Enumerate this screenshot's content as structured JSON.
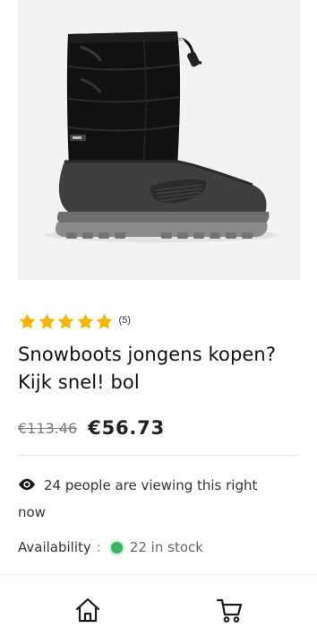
{
  "product": {
    "image_icon": "product-photo-snow-boot",
    "rating": {
      "stars": 5,
      "max_stars": 5,
      "star_color": "#f2b705",
      "count_label": "(5)"
    },
    "title": "Snowboots jongens kopen? Kijk snel! bol",
    "old_price": "€113.46",
    "price": "€56.73",
    "viewers_text": "24 people are viewing this right now",
    "viewers_icon": "eye-icon",
    "availability": {
      "label": "Availability",
      "separator": ":",
      "status_color": "#36b65c",
      "stock_text": "22 in stock"
    }
  },
  "bottom_nav": {
    "items": [
      {
        "icon": "home-icon"
      },
      {
        "icon": "cart-icon"
      }
    ]
  }
}
